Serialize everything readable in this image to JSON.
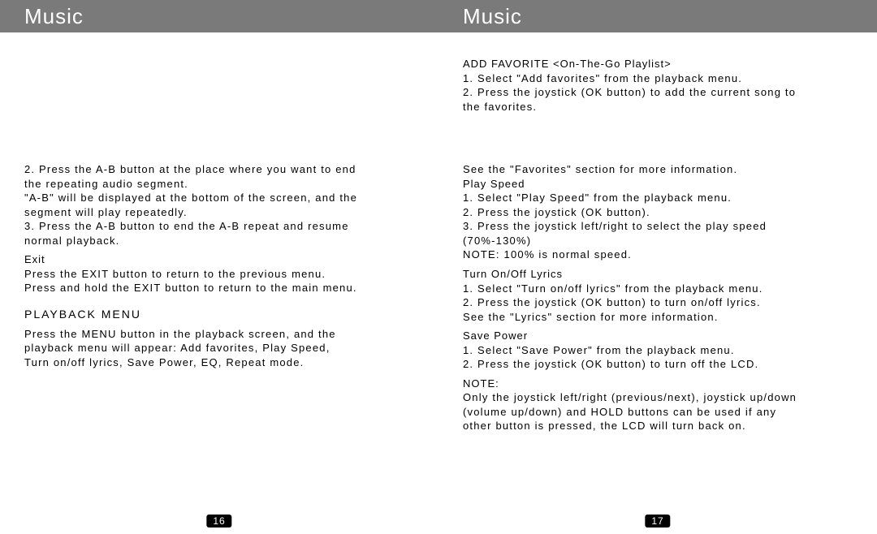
{
  "left": {
    "header": "Music",
    "body1": "2. Press the A-B button at the place where you want to end",
    "body2": "    the repeating audio segment.",
    "body3": "    \"A-B\" will be displayed at the bottom of the screen, and the",
    "body4": "    segment will play repeatedly.",
    "body5": "3. Press the A-B button to end the A-B repeat and resume",
    "body6": "    normal playback.",
    "exit_h": "Exit",
    "exit1": "   Press the EXIT button to return to the previous menu.",
    "exit2": "   Press and hold the EXIT button to return to the main menu.",
    "pbmenu_h": "PLAYBACK MENU",
    "pb1": "   Press the MENU button in the playback screen, and the",
    "pb2": "   playback menu will appear: Add favorites, Play Speed,",
    "pb3": "   Turn on/off lyrics, Save Power, EQ, Repeat mode.",
    "page_num": "16"
  },
  "right": {
    "header": "Music",
    "fav_h": "ADD FAVORITE <On-The-Go Playlist>",
    "fav1": "1. Select \"Add favorites\" from the playback menu.",
    "fav2": "2. Press the joystick (OK button) to add the current song to",
    "fav3": "    the favorites.",
    "fav_note": "See the \"Favorites\" section for more information.",
    "ps_h": "Play Speed",
    "ps1": "1. Select \"Play Speed\" from the playback menu.",
    "ps2": "2. Press the joystick (OK button).",
    "ps3": "3. Press the joystick left/right to select the play speed",
    "ps4": "    (70%-130%)",
    "ps_note": "NOTE: 100% is normal speed.",
    "lyr_h": "Turn On/Off Lyrics",
    "lyr1": "1. Select \"Turn on/off lyrics\" from the playback menu.",
    "lyr2": "2. Press the joystick (OK button) to turn on/off lyrics.",
    "lyr_note": "See the \"Lyrics\" section for more information.",
    "sp_h": "Save Power",
    "sp1": "1. Select \"Save Power\" from the playback menu.",
    "sp2": "2. Press the joystick (OK button) to turn off the LCD.",
    "note_h": "NOTE:",
    "note1": "Only the joystick left/right (previous/next), joystick up/down",
    "note2": "(volume up/down) and HOLD buttons can be used if any",
    "note3": "other button is pressed, the LCD will turn back on.",
    "page_num": "17"
  }
}
